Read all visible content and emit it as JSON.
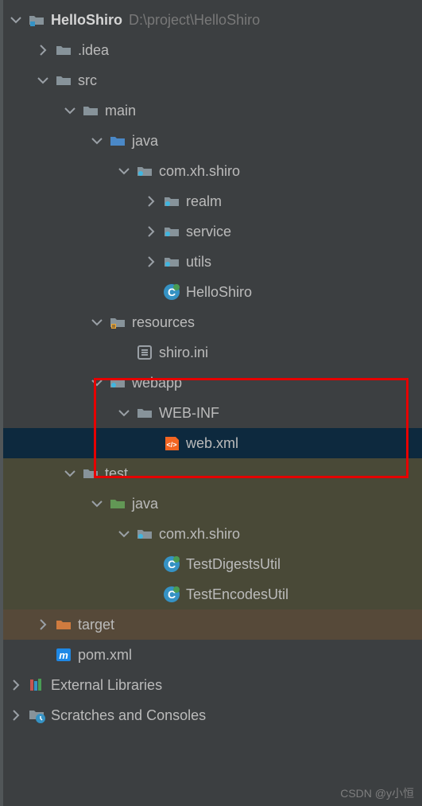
{
  "project": {
    "name": "HelloShiro",
    "path": "D:\\project\\HelloShiro"
  },
  "tree": {
    "idea": ".idea",
    "src": "src",
    "main": "main",
    "java_main": "java",
    "pkg_main": "com.xh.shiro",
    "realm": "realm",
    "service": "service",
    "utils": "utils",
    "hello_shiro_class": "HelloShiro",
    "resources": "resources",
    "shiro_ini": "shiro.ini",
    "webapp": "webapp",
    "web_inf": "WEB-INF",
    "web_xml": "web.xml",
    "test": "test",
    "java_test": "java",
    "pkg_test": "com.xh.shiro",
    "test_digests": "TestDigestsUtil",
    "test_encodes": "TestEncodesUtil",
    "target": "target",
    "pom": "pom.xml",
    "ext_lib": "External Libraries",
    "scratches": "Scratches and Consoles"
  },
  "watermark": "CSDN @y小恒"
}
